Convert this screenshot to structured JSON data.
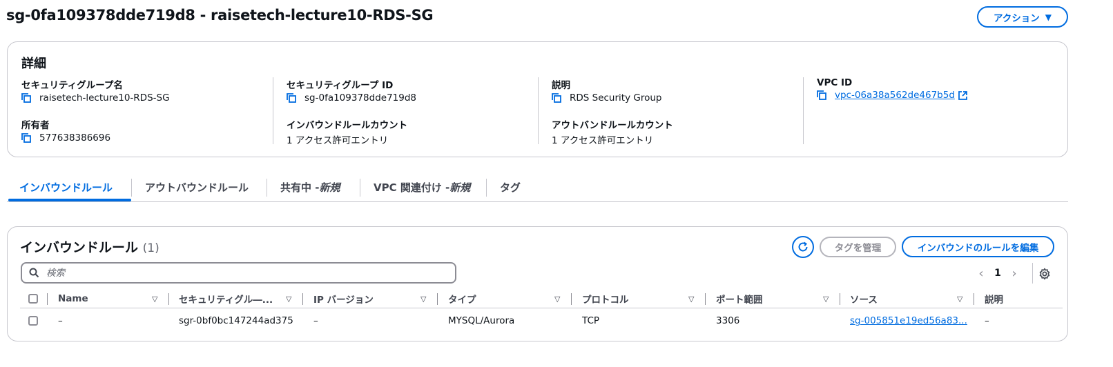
{
  "header": {
    "title": "sg-0fa109378dde719d8 - raisetech-lecture10-RDS-SG",
    "action_label": "アクション"
  },
  "details": {
    "title": "詳細",
    "fields": {
      "sg_name": {
        "label": "セキュリティグループ名",
        "value": "raisetech-lecture10-RDS-SG"
      },
      "sg_id": {
        "label": "セキュリティグループ ID",
        "value": "sg-0fa109378dde719d8"
      },
      "description": {
        "label": "説明",
        "value": "RDS Security Group"
      },
      "vpc_id": {
        "label": "VPC ID",
        "value": "vpc-06a38a562de467b5d"
      },
      "owner": {
        "label": "所有者",
        "value": "577638386696"
      },
      "inbound_count": {
        "label": "インバウンドルールカウント",
        "value": "1 アクセス許可エントリ"
      },
      "outbound_count": {
        "label": "アウトバンドルールカウント",
        "value": "1 アクセス許可エントリ"
      }
    }
  },
  "tabs": [
    {
      "label": "インバウンドルール",
      "new": ""
    },
    {
      "label": "アウトバウンドルール",
      "new": ""
    },
    {
      "label": "共有中 - ",
      "new": "新規"
    },
    {
      "label": "VPC 関連付け - ",
      "new": "新規"
    },
    {
      "label": "タグ",
      "new": ""
    }
  ],
  "rules": {
    "title": "インバウンドルール",
    "count": "(1)",
    "manage_tags_label": "タグを管理",
    "edit_label": "インバウンドのルールを編集",
    "search_placeholder": "検索",
    "page": "1",
    "columns": [
      "Name",
      "セキュリティグル―...",
      "IP バージョン",
      "タイプ",
      "プロトコル",
      "ポート範囲",
      "ソース",
      "説明"
    ],
    "rows": [
      {
        "name": "–",
        "rule_id": "sgr-0bf0bc147244ad375",
        "ip_version": "–",
        "type": "MYSQL/Aurora",
        "protocol": "TCP",
        "port": "3306",
        "source": "sg-005851e19ed56a83...",
        "description": "–"
      }
    ]
  },
  "colors": {
    "accent": "#006ce0",
    "border": "#c6c6cd",
    "text": "#0f141a",
    "disabled": "#8c8c94"
  }
}
